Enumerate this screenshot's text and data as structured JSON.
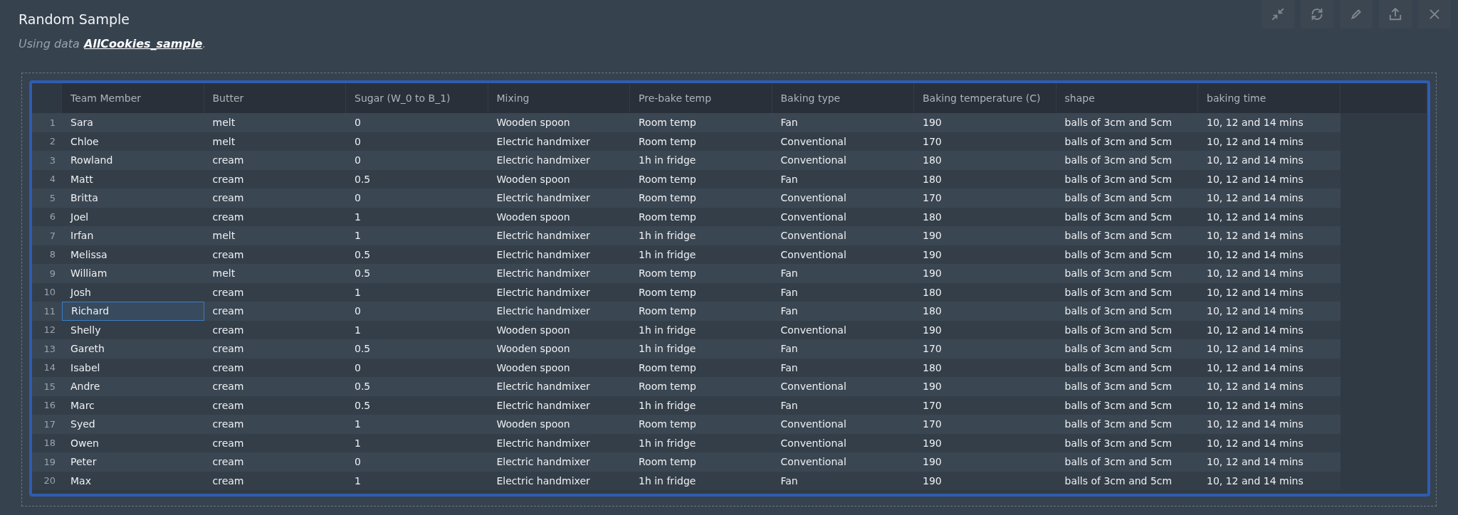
{
  "title": "Random Sample",
  "subtitle": {
    "prefix": "Using data",
    "link": "AllCookies_sample",
    "suffix": "."
  },
  "toolbar": [
    {
      "kind": "collapse"
    },
    {
      "kind": "refresh"
    },
    {
      "kind": "edit"
    },
    {
      "kind": "export"
    },
    {
      "kind": "close"
    }
  ],
  "table": {
    "columns": [
      "Team Member",
      "Butter",
      "Sugar (W_0 to B_1)",
      "Mixing",
      "Pre-bake temp",
      "Baking type",
      "Baking temperature (C)",
      "shape",
      "baking time"
    ],
    "rows": [
      {
        "number": "1",
        "cells": [
          {
            "text": "Sara",
            "selected": false
          },
          {
            "text": "melt",
            "selected": false
          },
          {
            "text": "0",
            "selected": false
          },
          {
            "text": "Wooden spoon",
            "selected": false
          },
          {
            "text": "Room temp",
            "selected": false
          },
          {
            "text": "Fan",
            "selected": false
          },
          {
            "text": "190",
            "selected": false
          },
          {
            "text": "balls of 3cm and 5cm",
            "selected": false
          },
          {
            "text": "10, 12 and 14 mins",
            "selected": false
          }
        ]
      },
      {
        "number": "2",
        "cells": [
          {
            "text": "Chloe",
            "selected": false
          },
          {
            "text": "melt",
            "selected": false
          },
          {
            "text": "0",
            "selected": false
          },
          {
            "text": "Electric handmixer",
            "selected": false
          },
          {
            "text": "Room temp",
            "selected": false
          },
          {
            "text": "Conventional",
            "selected": false
          },
          {
            "text": "170",
            "selected": false
          },
          {
            "text": "balls of 3cm and 5cm",
            "selected": false
          },
          {
            "text": "10, 12 and 14 mins",
            "selected": false
          }
        ]
      },
      {
        "number": "3",
        "cells": [
          {
            "text": "Rowland",
            "selected": false
          },
          {
            "text": "cream",
            "selected": false
          },
          {
            "text": "0",
            "selected": false
          },
          {
            "text": "Electric handmixer",
            "selected": false
          },
          {
            "text": "1h in fridge",
            "selected": false
          },
          {
            "text": "Conventional",
            "selected": false
          },
          {
            "text": "180",
            "selected": false
          },
          {
            "text": "balls of 3cm and 5cm",
            "selected": false
          },
          {
            "text": "10, 12 and 14 mins",
            "selected": false
          }
        ]
      },
      {
        "number": "4",
        "cells": [
          {
            "text": "Matt",
            "selected": false
          },
          {
            "text": "cream",
            "selected": false
          },
          {
            "text": "0.5",
            "selected": false
          },
          {
            "text": "Wooden spoon",
            "selected": false
          },
          {
            "text": "Room temp",
            "selected": false
          },
          {
            "text": "Fan",
            "selected": false
          },
          {
            "text": "180",
            "selected": false
          },
          {
            "text": "balls of 3cm and 5cm",
            "selected": false
          },
          {
            "text": "10, 12 and 14 mins",
            "selected": false
          }
        ]
      },
      {
        "number": "5",
        "cells": [
          {
            "text": "Britta",
            "selected": false
          },
          {
            "text": "cream",
            "selected": false
          },
          {
            "text": "0",
            "selected": false
          },
          {
            "text": "Electric handmixer",
            "selected": false
          },
          {
            "text": "Room temp",
            "selected": false
          },
          {
            "text": "Conventional",
            "selected": false
          },
          {
            "text": "170",
            "selected": false
          },
          {
            "text": "balls of 3cm and 5cm",
            "selected": false
          },
          {
            "text": "10, 12 and 14 mins",
            "selected": false
          }
        ]
      },
      {
        "number": "6",
        "cells": [
          {
            "text": "Joel",
            "selected": false
          },
          {
            "text": "cream",
            "selected": false
          },
          {
            "text": "1",
            "selected": false
          },
          {
            "text": "Wooden spoon",
            "selected": false
          },
          {
            "text": "Room temp",
            "selected": false
          },
          {
            "text": "Conventional",
            "selected": false
          },
          {
            "text": "180",
            "selected": false
          },
          {
            "text": "balls of 3cm and 5cm",
            "selected": false
          },
          {
            "text": "10, 12 and 14 mins",
            "selected": false
          }
        ]
      },
      {
        "number": "7",
        "cells": [
          {
            "text": "Irfan",
            "selected": false
          },
          {
            "text": "melt",
            "selected": false
          },
          {
            "text": "1",
            "selected": false
          },
          {
            "text": "Electric handmixer",
            "selected": false
          },
          {
            "text": "1h in fridge",
            "selected": false
          },
          {
            "text": "Conventional",
            "selected": false
          },
          {
            "text": "190",
            "selected": false
          },
          {
            "text": "balls of 3cm and 5cm",
            "selected": false
          },
          {
            "text": "10, 12 and 14 mins",
            "selected": false
          }
        ]
      },
      {
        "number": "8",
        "cells": [
          {
            "text": "Melissa",
            "selected": false
          },
          {
            "text": "cream",
            "selected": false
          },
          {
            "text": "0.5",
            "selected": false
          },
          {
            "text": "Electric handmixer",
            "selected": false
          },
          {
            "text": "1h in fridge",
            "selected": false
          },
          {
            "text": "Conventional",
            "selected": false
          },
          {
            "text": "190",
            "selected": false
          },
          {
            "text": "balls of 3cm and 5cm",
            "selected": false
          },
          {
            "text": "10, 12 and 14 mins",
            "selected": false
          }
        ]
      },
      {
        "number": "9",
        "cells": [
          {
            "text": "William",
            "selected": false
          },
          {
            "text": "melt",
            "selected": false
          },
          {
            "text": "0.5",
            "selected": false
          },
          {
            "text": "Electric handmixer",
            "selected": false
          },
          {
            "text": "Room temp",
            "selected": false
          },
          {
            "text": "Fan",
            "selected": false
          },
          {
            "text": "190",
            "selected": false
          },
          {
            "text": "balls of 3cm and 5cm",
            "selected": false
          },
          {
            "text": "10, 12 and 14 mins",
            "selected": false
          }
        ]
      },
      {
        "number": "10",
        "cells": [
          {
            "text": "Josh",
            "selected": false
          },
          {
            "text": "cream",
            "selected": false
          },
          {
            "text": "1",
            "selected": false
          },
          {
            "text": "Electric handmixer",
            "selected": false
          },
          {
            "text": "Room temp",
            "selected": false
          },
          {
            "text": "Fan",
            "selected": false
          },
          {
            "text": "180",
            "selected": false
          },
          {
            "text": "balls of 3cm and 5cm",
            "selected": false
          },
          {
            "text": "10, 12 and 14 mins",
            "selected": false
          }
        ]
      },
      {
        "number": "11",
        "cells": [
          {
            "text": "Richard",
            "selected": true
          },
          {
            "text": "cream",
            "selected": false
          },
          {
            "text": "0",
            "selected": false
          },
          {
            "text": "Electric handmixer",
            "selected": false
          },
          {
            "text": "Room temp",
            "selected": false
          },
          {
            "text": "Fan",
            "selected": false
          },
          {
            "text": "180",
            "selected": false
          },
          {
            "text": "balls of 3cm and 5cm",
            "selected": false
          },
          {
            "text": "10, 12 and 14 mins",
            "selected": false
          }
        ]
      },
      {
        "number": "12",
        "cells": [
          {
            "text": "Shelly",
            "selected": false
          },
          {
            "text": "cream",
            "selected": false
          },
          {
            "text": "1",
            "selected": false
          },
          {
            "text": "Wooden spoon",
            "selected": false
          },
          {
            "text": "1h in fridge",
            "selected": false
          },
          {
            "text": "Conventional",
            "selected": false
          },
          {
            "text": "190",
            "selected": false
          },
          {
            "text": "balls of 3cm and 5cm",
            "selected": false
          },
          {
            "text": "10, 12 and 14 mins",
            "selected": false
          }
        ]
      },
      {
        "number": "13",
        "cells": [
          {
            "text": "Gareth",
            "selected": false
          },
          {
            "text": "cream",
            "selected": false
          },
          {
            "text": "0.5",
            "selected": false
          },
          {
            "text": "Wooden spoon",
            "selected": false
          },
          {
            "text": "1h in fridge",
            "selected": false
          },
          {
            "text": "Fan",
            "selected": false
          },
          {
            "text": "170",
            "selected": false
          },
          {
            "text": "balls of 3cm and 5cm",
            "selected": false
          },
          {
            "text": "10, 12 and 14 mins",
            "selected": false
          }
        ]
      },
      {
        "number": "14",
        "cells": [
          {
            "text": "Isabel",
            "selected": false
          },
          {
            "text": "cream",
            "selected": false
          },
          {
            "text": "0",
            "selected": false
          },
          {
            "text": "Wooden spoon",
            "selected": false
          },
          {
            "text": "Room temp",
            "selected": false
          },
          {
            "text": "Fan",
            "selected": false
          },
          {
            "text": "180",
            "selected": false
          },
          {
            "text": "balls of 3cm and 5cm",
            "selected": false
          },
          {
            "text": "10, 12 and 14 mins",
            "selected": false
          }
        ]
      },
      {
        "number": "15",
        "cells": [
          {
            "text": "Andre",
            "selected": false
          },
          {
            "text": "cream",
            "selected": false
          },
          {
            "text": "0.5",
            "selected": false
          },
          {
            "text": "Electric handmixer",
            "selected": false
          },
          {
            "text": "Room temp",
            "selected": false
          },
          {
            "text": "Conventional",
            "selected": false
          },
          {
            "text": "190",
            "selected": false
          },
          {
            "text": "balls of 3cm and 5cm",
            "selected": false
          },
          {
            "text": "10, 12 and 14 mins",
            "selected": false
          }
        ]
      },
      {
        "number": "16",
        "cells": [
          {
            "text": "Marc",
            "selected": false
          },
          {
            "text": "cream",
            "selected": false
          },
          {
            "text": "0.5",
            "selected": false
          },
          {
            "text": "Electric handmixer",
            "selected": false
          },
          {
            "text": "1h in fridge",
            "selected": false
          },
          {
            "text": "Fan",
            "selected": false
          },
          {
            "text": "170",
            "selected": false
          },
          {
            "text": "balls of 3cm and 5cm",
            "selected": false
          },
          {
            "text": "10, 12 and 14 mins",
            "selected": false
          }
        ]
      },
      {
        "number": "17",
        "cells": [
          {
            "text": "Syed",
            "selected": false
          },
          {
            "text": "cream",
            "selected": false
          },
          {
            "text": "1",
            "selected": false
          },
          {
            "text": "Wooden spoon",
            "selected": false
          },
          {
            "text": "Room temp",
            "selected": false
          },
          {
            "text": "Conventional",
            "selected": false
          },
          {
            "text": "170",
            "selected": false
          },
          {
            "text": "balls of 3cm and 5cm",
            "selected": false
          },
          {
            "text": "10, 12 and 14 mins",
            "selected": false
          }
        ]
      },
      {
        "number": "18",
        "cells": [
          {
            "text": "Owen",
            "selected": false
          },
          {
            "text": "cream",
            "selected": false
          },
          {
            "text": "1",
            "selected": false
          },
          {
            "text": "Electric handmixer",
            "selected": false
          },
          {
            "text": "1h in fridge",
            "selected": false
          },
          {
            "text": "Conventional",
            "selected": false
          },
          {
            "text": "190",
            "selected": false
          },
          {
            "text": "balls of 3cm and 5cm",
            "selected": false
          },
          {
            "text": "10, 12 and 14 mins",
            "selected": false
          }
        ]
      },
      {
        "number": "19",
        "cells": [
          {
            "text": "Peter",
            "selected": false
          },
          {
            "text": "cream",
            "selected": false
          },
          {
            "text": "0",
            "selected": false
          },
          {
            "text": "Electric handmixer",
            "selected": false
          },
          {
            "text": "Room temp",
            "selected": false
          },
          {
            "text": "Conventional",
            "selected": false
          },
          {
            "text": "190",
            "selected": false
          },
          {
            "text": "balls of 3cm and 5cm",
            "selected": false
          },
          {
            "text": "10, 12 and 14 mins",
            "selected": false
          }
        ]
      },
      {
        "number": "20",
        "cells": [
          {
            "text": "Max",
            "selected": false
          },
          {
            "text": "cream",
            "selected": false
          },
          {
            "text": "1",
            "selected": false
          },
          {
            "text": "Electric handmixer",
            "selected": false
          },
          {
            "text": "1h in fridge",
            "selected": false
          },
          {
            "text": "Fan",
            "selected": false
          },
          {
            "text": "190",
            "selected": false
          },
          {
            "text": "balls of 3cm and 5cm",
            "selected": false
          },
          {
            "text": "10, 12 and 14 mins",
            "selected": false
          }
        ]
      }
    ]
  }
}
